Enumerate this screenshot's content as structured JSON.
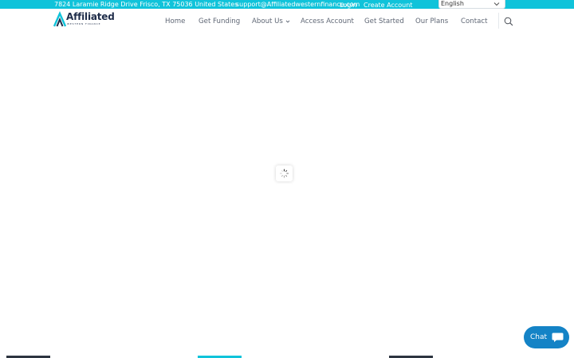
{
  "topbar": {
    "address": "7824 Laramie Ridge Drive Frisco, TX 75036 United States",
    "email": "support@Affiliatedwesternfinance.com",
    "login": "Login",
    "create_account": "Create Account"
  },
  "language": {
    "selected": "English"
  },
  "logo": {
    "word": "Affiliated",
    "subtitle": "WESTERN FINANCE"
  },
  "nav": {
    "home": "Home",
    "get_funding": "Get Funding",
    "about_us": "About Us",
    "access_account": "Access Account",
    "get_started": "Get Started",
    "our_plans": "Our Plans",
    "contact": "Contact"
  },
  "chat": {
    "label": "Chat"
  },
  "colors": {
    "topbar": "#10c3da",
    "chat": "#1483c6",
    "logo_text": "#1f2d4a"
  },
  "icons": {
    "search": "search-icon",
    "loader": "spinner-icon",
    "chat": "chat-bubble-icon",
    "dropdown": "chevron-down-icon"
  }
}
